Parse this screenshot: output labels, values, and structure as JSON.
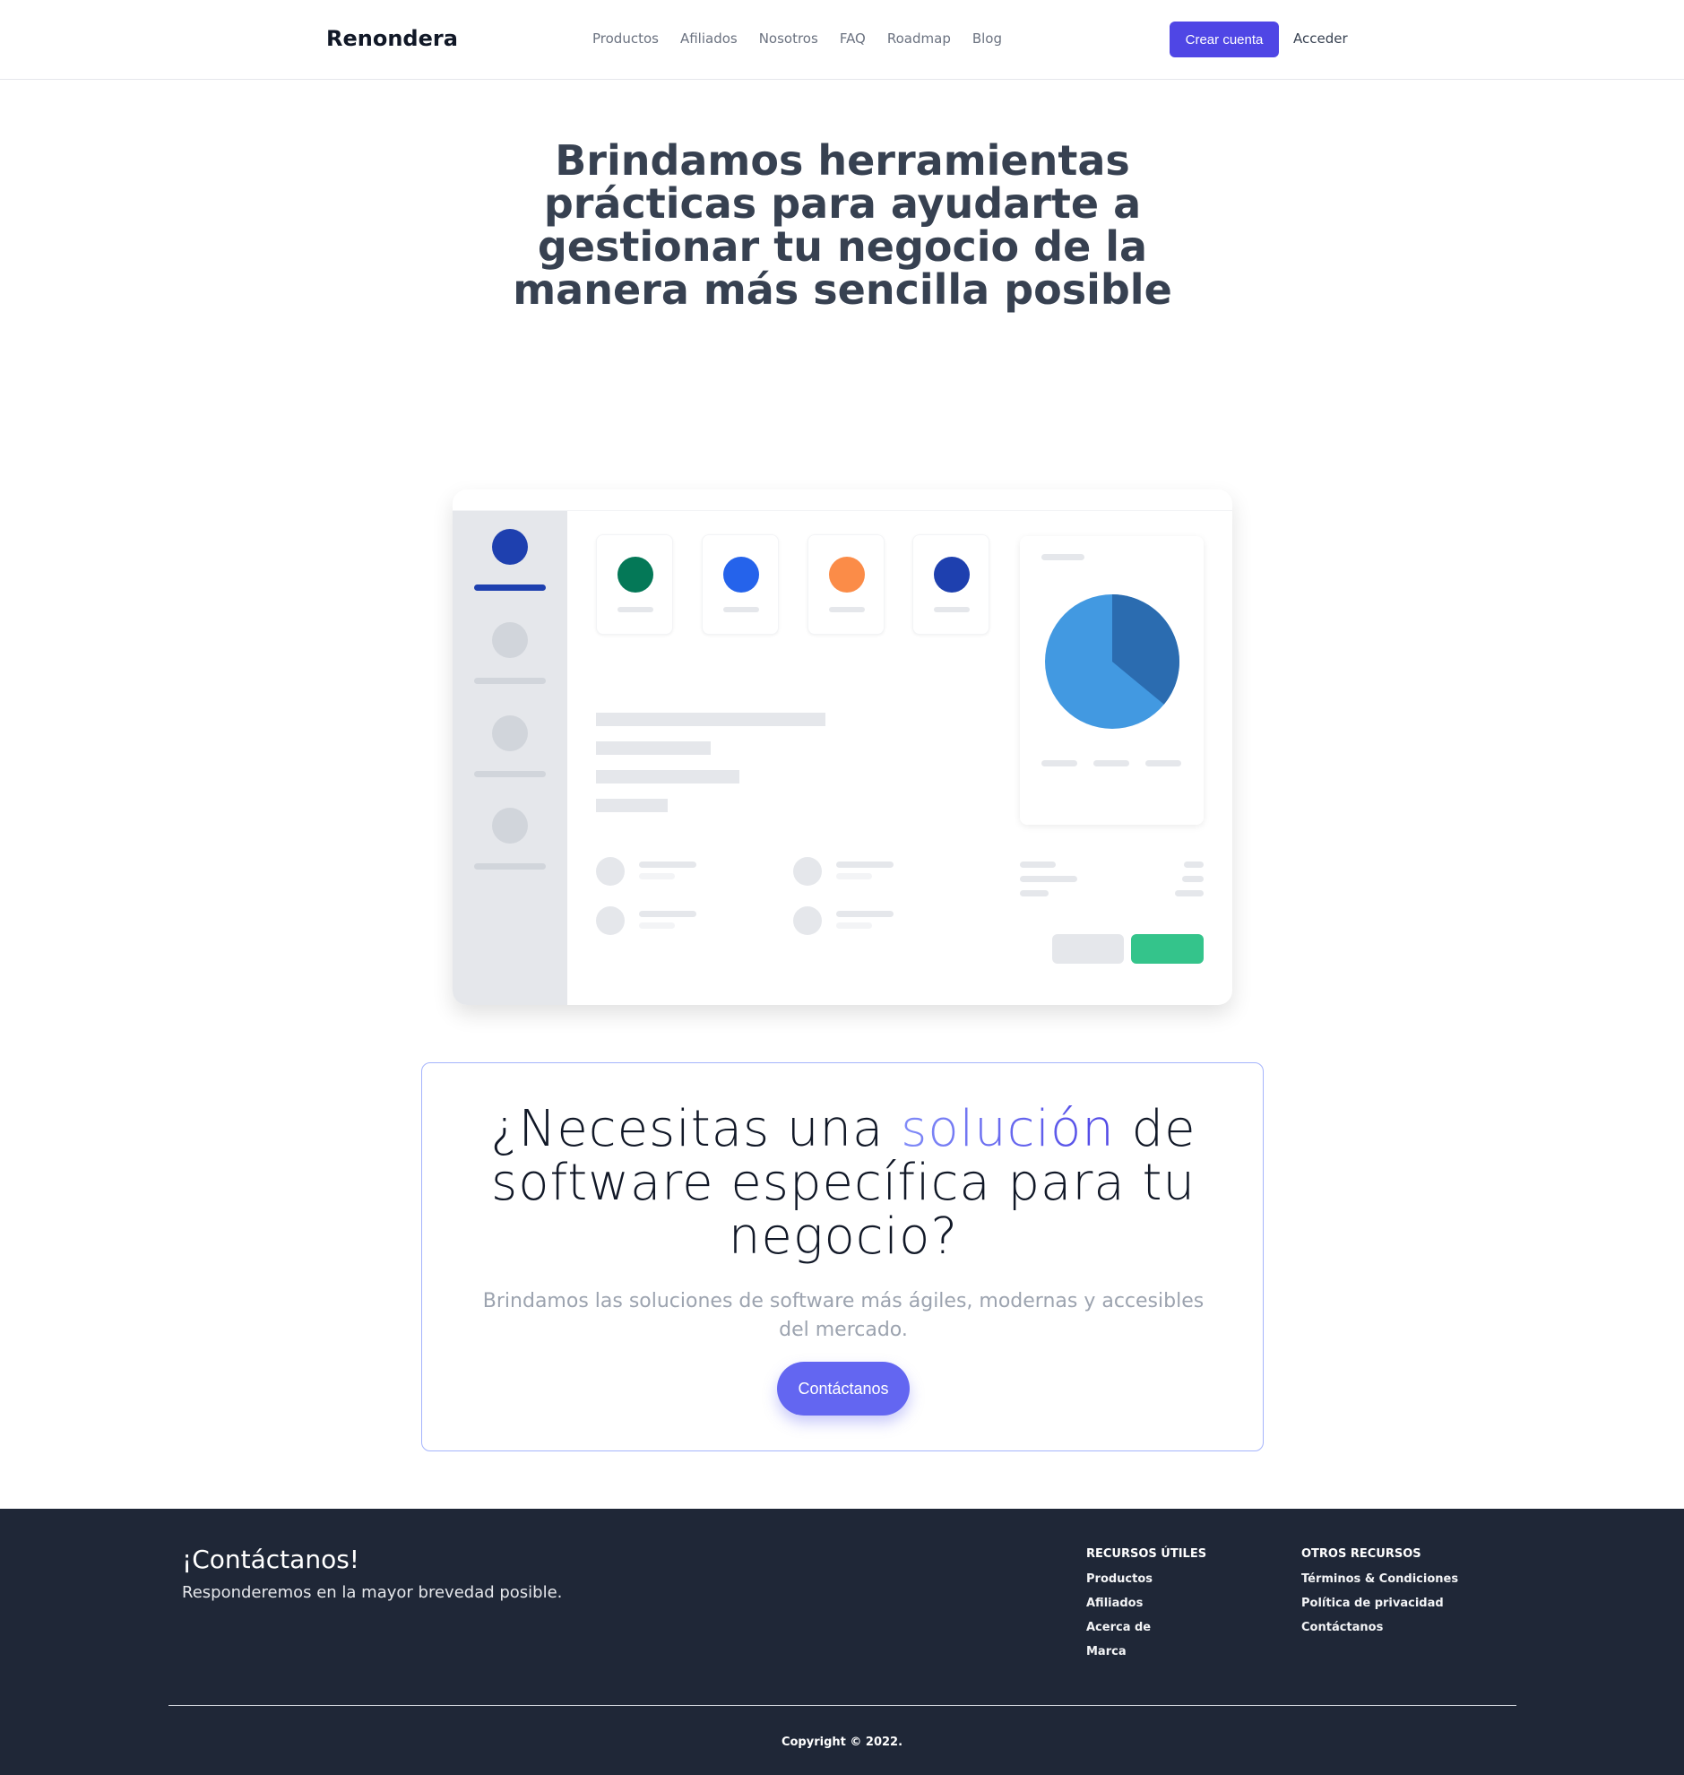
{
  "nav": {
    "brand": "Renondera",
    "links": [
      "Productos",
      "Afiliados",
      "Nosotros",
      "FAQ",
      "Roadmap",
      "Blog"
    ],
    "create_account": "Crear cuenta",
    "login": "Acceder"
  },
  "hero": {
    "title": "Brindamos herramientas prácticas para ayudarte a gestionar tu negocio de la manera más sencilla posible"
  },
  "dashboard": {
    "card_colors": [
      "#047857",
      "#2563eb",
      "#fb8c48",
      "#1e40af"
    ],
    "pie_colors": [
      "#4299e1",
      "#2b6cb0"
    ],
    "pie_dark_slice_fraction": 0.36,
    "button_colors": [
      "#e5e7eb",
      "#34c48b"
    ]
  },
  "cta": {
    "title_before": "¿Necesitas una ",
    "title_accent": "solución",
    "title_after": " de software específica para tu negocio?",
    "subtitle": "Brindamos las soluciones de software más ágiles, modernas y accesibles del mercado.",
    "button": "Contáctanos"
  },
  "footer": {
    "title": "¡Contáctanos!",
    "subtitle": "Responderemos en la mayor brevedad posible.",
    "col1": {
      "heading": "RECURSOS ÚTILES",
      "links": [
        "Productos",
        "Afiliados",
        "Acerca de",
        "Marca"
      ]
    },
    "col2": {
      "heading": "OTROS RECURSOS",
      "links": [
        "Términos & Condiciones",
        "Política de privacidad",
        "Contáctanos"
      ]
    },
    "copyright": "Copyright © 2022."
  }
}
